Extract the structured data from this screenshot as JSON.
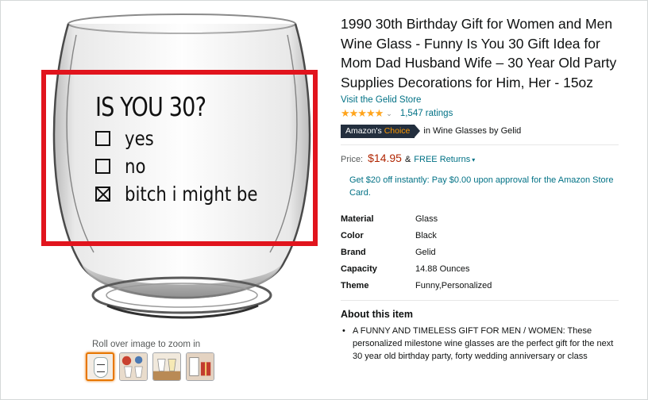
{
  "gallery": {
    "glass_title": "IS YOU 30?",
    "options": [
      {
        "label": "yes",
        "checked": false
      },
      {
        "label": "no",
        "checked": false
      },
      {
        "label": "bitch i might be",
        "checked": true
      }
    ],
    "zoom_hint": "Roll over image to zoom in",
    "thumbnails": [
      "glass-thumb",
      "party-scene-thumb",
      "table-scene-thumb",
      "gift-scene-thumb"
    ],
    "highlight_color": "#e1141d"
  },
  "product": {
    "title": "1990 30th Birthday Gift for Women and Men Wine Glass - Funny Is You 30 Gift Idea for Mom Dad Husband Wife – 30 Year Old Party Supplies Decorations for Him, Her - 15oz",
    "store_link": "Visit the Gelid Store",
    "stars": "★★★★★",
    "rating_value": 4.6,
    "ratings_count": "1,547 ratings",
    "choice_badge_prefix": "Amazon's",
    "choice_badge_suffix": "Choice",
    "choice_text": "in Wine Glasses by Gelid",
    "price_label": "Price:",
    "price": "$14.95",
    "amp": "&",
    "free_returns": "FREE Returns",
    "card_offer": "Get $20 off instantly: Pay $0.00 upon approval for the Amazon Store Card.",
    "specs": [
      {
        "key": "Material",
        "value": "Glass"
      },
      {
        "key": "Color",
        "value": "Black"
      },
      {
        "key": "Brand",
        "value": "Gelid"
      },
      {
        "key": "Capacity",
        "value": "14.88 Ounces"
      },
      {
        "key": "Theme",
        "value": "Funny,Personalized"
      }
    ],
    "about_title": "About this item",
    "about_items": [
      "A FUNNY AND TIMELESS GIFT FOR MEN / WOMEN: These personalized milestone wine glasses are the perfect gift for the next 30 year old birthday party, forty wedding anniversary or class"
    ]
  },
  "colors": {
    "link": "#007185",
    "price": "#b12704",
    "star": "#ffa41c",
    "badge_bg": "#232f3e",
    "badge_accent": "#ff9900",
    "thumb_active": "#e77600"
  }
}
